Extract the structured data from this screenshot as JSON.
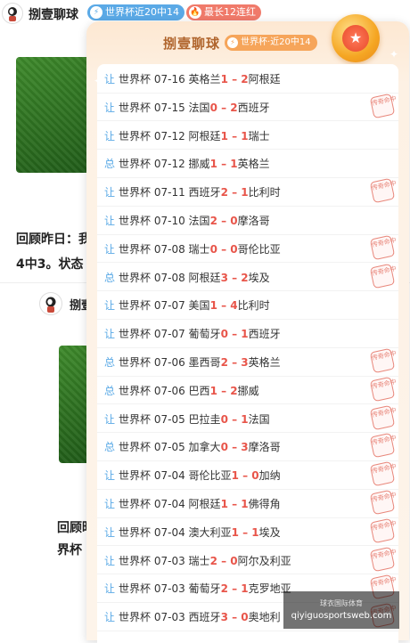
{
  "topbar": {
    "author": "捌壹聊球",
    "badge_world_cup": "世界杯近20中14",
    "badge_streak": "最长12连红"
  },
  "article": {
    "line1": "回顾昨日：我",
    "line2": "4中3。状态",
    "author2": "捌壹",
    "line3": "回顾昨",
    "line4": "界杯"
  },
  "panel": {
    "title": "捌壹聊球",
    "title_badge": "世界杯·近20中14",
    "stamp_text": "传奇命中",
    "rows": [
      {
        "type": "让",
        "league": "世界杯",
        "date": "07-16",
        "home": "英格兰",
        "hs": "1",
        "sep": " – ",
        "as": "2",
        "away": "阿根廷",
        "stamp": false
      },
      {
        "type": "让",
        "league": "世界杯",
        "date": "07-15",
        "home": "法国",
        "hs": "0",
        "sep": " – ",
        "as": "2",
        "away": "西班牙",
        "stamp": true
      },
      {
        "type": "让",
        "league": "世界杯",
        "date": "07-12",
        "home": "阿根廷",
        "hs": "1",
        "sep": " – ",
        "as": "1",
        "away": "瑞士",
        "stamp": false
      },
      {
        "type": "总",
        "league": "世界杯",
        "date": "07-12",
        "home": "挪威",
        "hs": "1",
        "sep": " – ",
        "as": "1",
        "away": "英格兰",
        "stamp": false
      },
      {
        "type": "让",
        "league": "世界杯",
        "date": "07-11",
        "home": "西班牙",
        "hs": "2",
        "sep": " – ",
        "as": "1",
        "away": "比利时",
        "stamp": true
      },
      {
        "type": "让",
        "league": "世界杯",
        "date": "07-10",
        "home": "法国",
        "hs": "2",
        "sep": " – ",
        "as": "0",
        "away": "摩洛哥",
        "stamp": false
      },
      {
        "type": "让",
        "league": "世界杯",
        "date": "07-08",
        "home": "瑞士",
        "hs": "0",
        "sep": " – ",
        "as": "0",
        "away": "哥伦比亚",
        "stamp": true
      },
      {
        "type": "总",
        "league": "世界杯",
        "date": "07-08",
        "home": "阿根廷",
        "hs": "3",
        "sep": " – ",
        "as": "2",
        "away": "埃及",
        "stamp": true
      },
      {
        "type": "让",
        "league": "世界杯",
        "date": "07-07",
        "home": "美国",
        "hs": "1",
        "sep": " – ",
        "as": "4",
        "away": "比利时",
        "stamp": false
      },
      {
        "type": "让",
        "league": "世界杯",
        "date": "07-07",
        "home": "葡萄牙",
        "hs": "0",
        "sep": " – ",
        "as": "1",
        "away": "西班牙",
        "stamp": false
      },
      {
        "type": "总",
        "league": "世界杯",
        "date": "07-06",
        "home": "墨西哥",
        "hs": "2",
        "sep": " – ",
        "as": "3",
        "away": "英格兰",
        "stamp": true
      },
      {
        "type": "总",
        "league": "世界杯",
        "date": "07-06",
        "home": "巴西",
        "hs": "1",
        "sep": " – ",
        "as": "2",
        "away": "挪威",
        "stamp": true
      },
      {
        "type": "让",
        "league": "世界杯",
        "date": "07-05",
        "home": "巴拉圭",
        "hs": "0",
        "sep": " – ",
        "as": "1",
        "away": "法国",
        "stamp": true
      },
      {
        "type": "总",
        "league": "世界杯",
        "date": "07-05",
        "home": "加拿大",
        "hs": "0",
        "sep": " – ",
        "as": "3",
        "away": "摩洛哥",
        "stamp": true
      },
      {
        "type": "让",
        "league": "世界杯",
        "date": "07-04",
        "home": "哥伦比亚",
        "hs": "1",
        "sep": " – ",
        "as": "0",
        "away": "加纳",
        "stamp": true
      },
      {
        "type": "让",
        "league": "世界杯",
        "date": "07-04",
        "home": "阿根廷",
        "hs": "1",
        "sep": " – ",
        "as": "1",
        "away": "佛得角",
        "stamp": true
      },
      {
        "type": "让",
        "league": "世界杯",
        "date": "07-04",
        "home": "澳大利亚",
        "hs": "1",
        "sep": " – ",
        "as": "1",
        "away": "埃及",
        "stamp": true
      },
      {
        "type": "让",
        "league": "世界杯",
        "date": "07-03",
        "home": "瑞士",
        "hs": "2",
        "sep": " – ",
        "as": "0",
        "away": "阿尔及利亚",
        "stamp": true
      },
      {
        "type": "让",
        "league": "世界杯",
        "date": "07-03",
        "home": "葡萄牙",
        "hs": "2",
        "sep": " – ",
        "as": "1",
        "away": "克罗地亚",
        "stamp": true
      },
      {
        "type": "让",
        "league": "世界杯",
        "date": "07-03",
        "home": "西班牙",
        "hs": "3",
        "sep": " – ",
        "as": "0",
        "away": "奥地利",
        "stamp": true
      }
    ]
  },
  "watermark": {
    "line1": "球衣国际体育",
    "line2": "qiyiguosportsweb.com"
  },
  "colors": {
    "score_red": "#e8554a",
    "type_blue": "#5aa9e6",
    "title_brown": "#b0652d",
    "badge_orange": "#f6a55a"
  }
}
